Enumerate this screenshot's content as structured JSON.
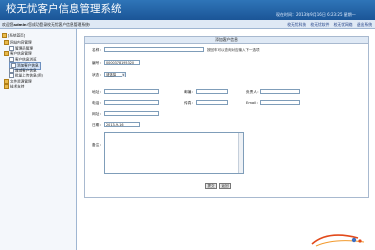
{
  "app": {
    "title": "校无忧客户信息管理系统",
    "datetime": "现在时间：2013年9月16日 6:23:25 星期一"
  },
  "topbar": {
    "welcome_prefix": "欢迎您",
    "user": "admin",
    "welcome_suffix": "!您成功登录校无忧客户信息管理系统!",
    "links": [
      "校无忧科技",
      "校无忧软件",
      "校无忧网络",
      "退出系统"
    ]
  },
  "sidebar": {
    "items": [
      {
        "label": "[系统首页]",
        "type": "folder",
        "level": 0
      },
      {
        "label": "网站内容管理",
        "type": "folder",
        "level": 1
      },
      {
        "label": "管理员管理",
        "type": "page",
        "level": 2
      },
      {
        "label": "客户信息管理",
        "type": "folder",
        "level": 1
      },
      {
        "label": "客户信息浏览",
        "type": "page",
        "level": 2
      },
      {
        "label": "添加客户信息",
        "type": "page",
        "level": 2,
        "selected": true
      },
      {
        "label": "增减客户信息",
        "type": "page",
        "level": 2
      },
      {
        "label": "批量上传信息(用)",
        "type": "page",
        "level": 2
      },
      {
        "label": "文件资源管理",
        "type": "folder",
        "level": 1
      },
      {
        "label": "技术支持",
        "type": "folder",
        "level": 1
      }
    ]
  },
  "form": {
    "heading": "添加客户信息",
    "labels": {
      "name": "名称：",
      "code": "编号：",
      "status": "状态：",
      "address": "地址：",
      "postcode": "邮编：",
      "contact": "负责人：",
      "phone": "电话：",
      "fax": "传真：",
      "email": "Email：",
      "url": "网址：",
      "date": "日期：",
      "remark": "备注："
    },
    "values": {
      "name": "",
      "code": "0000378195320",
      "status": "请选择",
      "date": "2013-9-16"
    },
    "hints": {
      "name": "按回车可以查询对应输入下一选项"
    },
    "buttons": {
      "submit": "提交",
      "back": "返回"
    }
  },
  "colors": {
    "header": "#2f75b8",
    "subbar": "#dfe9f5",
    "border": "#a8b9cf"
  }
}
